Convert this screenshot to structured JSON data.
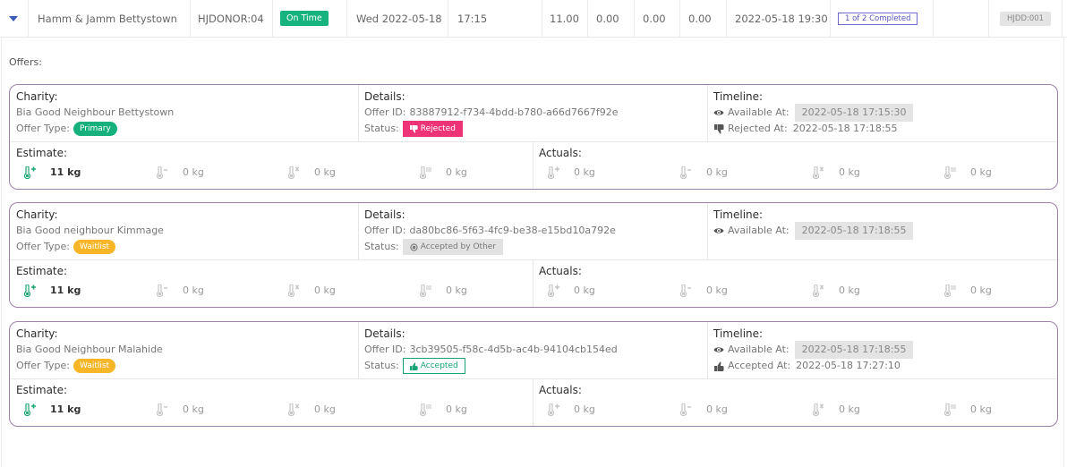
{
  "summary": {
    "name": "Hamm & Jamm Bettystown",
    "donor_code": "HJDONOR:04",
    "on_time": "On Time",
    "date": "Wed 2022-05-18",
    "time": "17:15",
    "v1": "11.00",
    "v2": "0.00",
    "v3": "0.00",
    "v4": "0.00",
    "datetime": "2022-05-18 19:30",
    "completed": "1 of 2 Completed",
    "code": "HJDD:001"
  },
  "offers_label": "Offers:",
  "labels": {
    "charity": "Charity:",
    "details": "Details:",
    "timeline": "Timeline:",
    "estimate": "Estimate:",
    "actuals": "Actuals:",
    "offer_type": "Offer Type:",
    "offer_id": "Offer ID:",
    "status": "Status:",
    "available_at": "Available At:",
    "rejected_at": "Rejected At:",
    "accepted_at": "Accepted At:"
  },
  "offers": [
    {
      "charity": "Bia Good Neighbour Bettystown",
      "type": "Primary",
      "offer_id": "83887912-f734-4bdd-b780-a66d7667f92e",
      "status": "Rejected",
      "available_at": "2022-05-18 17:15:30",
      "event_at": "2022-05-18 17:18:55",
      "estimate": [
        "11 kg",
        "0 kg",
        "0 kg",
        "0 kg"
      ],
      "actuals": [
        "0 kg",
        "0 kg",
        "0 kg",
        "0 kg"
      ]
    },
    {
      "charity": "Bia Good neighbour Kimmage",
      "type": "Waitlist",
      "offer_id": "da80bc86-5f63-4fc9-be38-e15bd10a792e",
      "status": "Accepted by Other",
      "available_at": "2022-05-18 17:18:55",
      "estimate": [
        "11 kg",
        "0 kg",
        "0 kg",
        "0 kg"
      ],
      "actuals": [
        "0 kg",
        "0 kg",
        "0 kg",
        "0 kg"
      ]
    },
    {
      "charity": "Bia Good Neighbour Malahide",
      "type": "Waitlist",
      "offer_id": "3cb39505-f58c-4d5b-ac4b-94104cb154ed",
      "status": "Accepted",
      "available_at": "2022-05-18 17:18:55",
      "event_at": "2022-05-18 17:27:10",
      "estimate": [
        "11 kg",
        "0 kg",
        "0 kg",
        "0 kg"
      ],
      "actuals": [
        "0 kg",
        "0 kg",
        "0 kg",
        "0 kg"
      ]
    }
  ],
  "icons": {
    "expand": "chevron-down-icon",
    "available": "eye-icon",
    "rejected": "thumbs-down-icon",
    "accepted": "thumbs-up-icon",
    "accepted_by_other": "dot-circle-icon",
    "metrics": [
      "thermometer-plus-icon",
      "thermometer-minus-icon",
      "thermometer-snowflake-icon",
      "thermometer-grid-icon"
    ]
  },
  "colors": {
    "accent": "#3b5bb8",
    "success": "#16b37e",
    "danger": "#ee3377",
    "warning": "#f7b628",
    "card_border": "#9c80a9"
  }
}
